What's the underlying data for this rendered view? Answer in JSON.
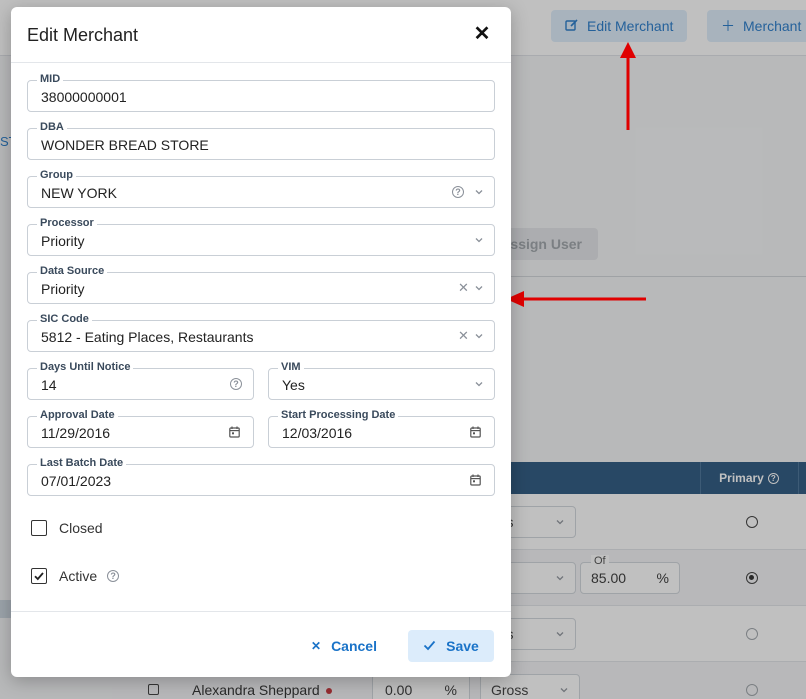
{
  "background": {
    "edit_merchant_button": "Edit Merchant",
    "add_merchant_button": "Merchant",
    "side_text": "ST",
    "assign_user_button": "Assign User",
    "table": {
      "primary_header": "Primary",
      "rows": [
        {
          "select": "ross",
          "percent_label": "",
          "percent": "",
          "primary": "off"
        },
        {
          "select": "t",
          "percent_label": "Of",
          "percent": "85.00",
          "primary": "on"
        },
        {
          "select": "ross",
          "percent_label": "",
          "percent": "",
          "primary": "off"
        },
        {
          "name": "Alexandra Sheppard",
          "amount": "0.00",
          "select": "Gross",
          "primary": "off"
        }
      ]
    }
  },
  "modal": {
    "title": "Edit Merchant",
    "fields": {
      "mid": {
        "label": "MID",
        "value": "38000000001"
      },
      "dba": {
        "label": "DBA",
        "value": "WONDER BREAD STORE"
      },
      "group": {
        "label": "Group",
        "value": "NEW YORK"
      },
      "processor": {
        "label": "Processor",
        "value": "Priority"
      },
      "data_source": {
        "label": "Data Source",
        "value": "Priority"
      },
      "sic_code": {
        "label": "SIC Code",
        "value": "5812 - Eating Places, Restaurants"
      },
      "days_until_notice": {
        "label": "Days Until Notice",
        "value": "14"
      },
      "vim": {
        "label": "VIM",
        "value": "Yes"
      },
      "approval_date": {
        "label": "Approval Date",
        "value": "11/29/2016"
      },
      "start_processing_date": {
        "label": "Start Processing Date",
        "value": "12/03/2016"
      },
      "last_batch_date": {
        "label": "Last Batch Date",
        "value": "07/01/2023"
      }
    },
    "closed": {
      "label": "Closed",
      "checked": false
    },
    "active": {
      "label": "Active",
      "checked": true
    },
    "cancel_label": "Cancel",
    "save_label": "Save"
  },
  "colors": {
    "accent": "#1a73c8",
    "button_bg": "#dcecfb",
    "table_header": "#1f4e79",
    "annotation_arrow": "#e00000"
  },
  "icons": {
    "close": "close-icon",
    "chevron": "chevron-down-icon",
    "help": "help-icon",
    "clear": "clear-icon",
    "calendar": "calendar-icon",
    "edit": "edit-icon",
    "plus": "plus-icon",
    "check": "check-icon"
  }
}
